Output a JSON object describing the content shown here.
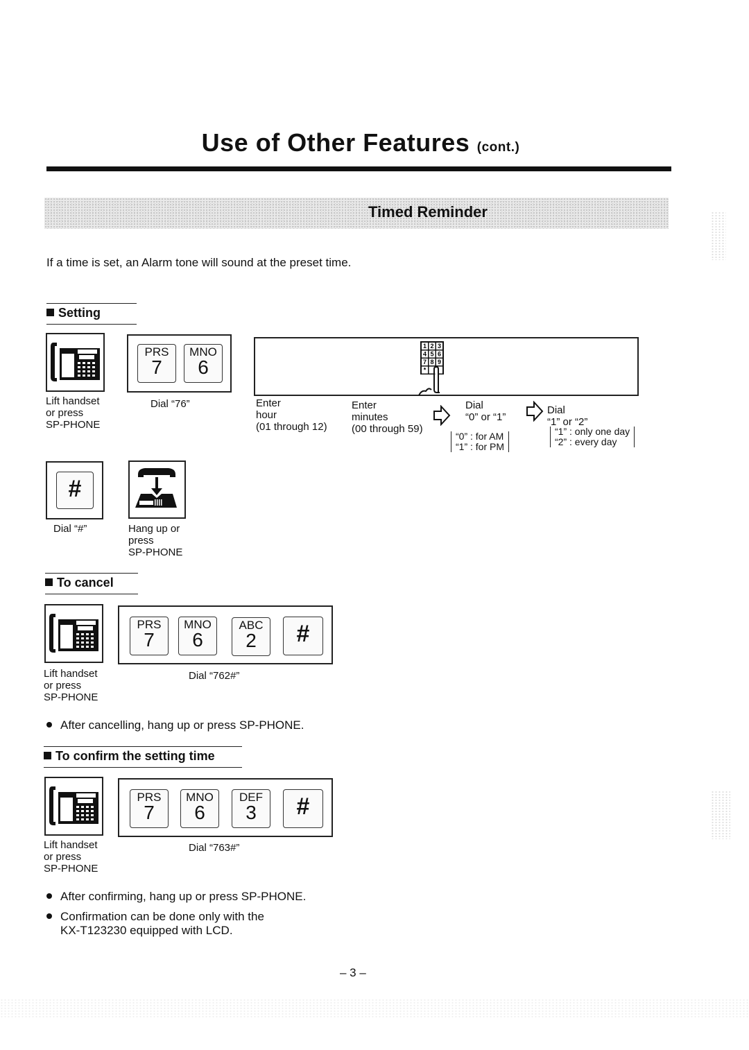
{
  "page": {
    "title": "Use of Other Features",
    "title_suffix": "(cont.)",
    "page_number": "– 3 –"
  },
  "section": {
    "title": "Timed Reminder",
    "intro": "If a time is set, an Alarm tone will sound at the preset time."
  },
  "setting": {
    "heading": "Setting",
    "step_lift": {
      "icon": "phone-handset-icon",
      "caption": [
        "Lift handset",
        "or press",
        "SP-PHONE"
      ]
    },
    "step_dial": {
      "keys": [
        {
          "letters": "PRS",
          "digit": "7"
        },
        {
          "letters": "MNO",
          "digit": "6"
        }
      ],
      "caption": "Dial “76”"
    },
    "keypad_icon": {
      "rows": [
        [
          "1",
          "2",
          "3"
        ],
        [
          "4",
          "5",
          "6"
        ],
        [
          "7",
          "8",
          "9"
        ],
        [
          "*",
          "0",
          "#"
        ]
      ]
    },
    "enter_hour": [
      "Enter",
      "hour",
      "(01 through 12)"
    ],
    "enter_minutes": [
      "Enter",
      "minutes",
      "(00 through 59)"
    ],
    "dial_ampm": {
      "label": [
        "Dial",
        "“0” or “1”"
      ],
      "options": [
        "“0” : for AM",
        "“1” : for PM"
      ]
    },
    "dial_days": {
      "label": [
        "Dial",
        "“1” or “2”"
      ],
      "options": [
        "“1” : only one day",
        "“2” : every day"
      ]
    },
    "step_hash": {
      "key": "#",
      "caption": "Dial “#”"
    },
    "step_hangup": {
      "icon": "hang-up-icon",
      "caption": [
        "Hang up or",
        "press",
        "SP-PHONE"
      ]
    }
  },
  "cancel": {
    "heading": "To cancel",
    "step_lift": {
      "caption": [
        "Lift handset",
        "or press",
        "SP-PHONE"
      ]
    },
    "keys": [
      {
        "letters": "PRS",
        "digit": "7"
      },
      {
        "letters": "MNO",
        "digit": "6"
      },
      {
        "letters": "ABC",
        "digit": "2"
      },
      {
        "letters": "",
        "digit": "#"
      }
    ],
    "caption": "Dial “762#”",
    "notes": [
      "After cancelling, hang up or press SP-PHONE."
    ]
  },
  "confirm": {
    "heading": "To confirm the setting time",
    "step_lift": {
      "caption": [
        "Lift handset",
        "or press",
        "SP-PHONE"
      ]
    },
    "keys": [
      {
        "letters": "PRS",
        "digit": "7"
      },
      {
        "letters": "MNO",
        "digit": "6"
      },
      {
        "letters": "DEF",
        "digit": "3"
      },
      {
        "letters": "",
        "digit": "#"
      }
    ],
    "caption": "Dial “763#”",
    "notes": [
      "After confirming, hang up or press SP-PHONE.",
      "Confirmation can be done only with the",
      "KX-T123230 equipped with LCD."
    ]
  }
}
